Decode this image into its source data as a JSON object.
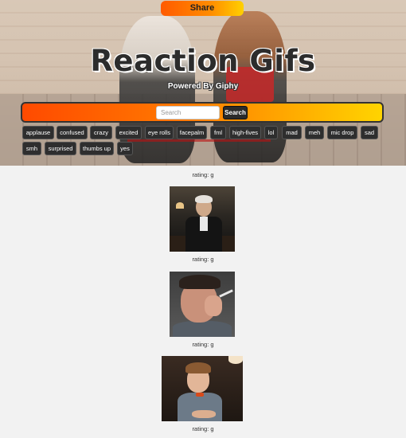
{
  "header": {
    "share_label": "Share",
    "title": "Reaction Gifs",
    "subtitle": "Powered By Giphy"
  },
  "search": {
    "placeholder": "Search",
    "button_label": "Search"
  },
  "tags": [
    "applause",
    "confused",
    "crazy",
    "excited",
    "eye rolls",
    "facepalm",
    "fml",
    "high-fives",
    "lol",
    "mad",
    "meh",
    "mic drop",
    "sad",
    "smh",
    "surprised",
    "thumbs up",
    "yes"
  ],
  "feed": {
    "top_rating": "rating: g",
    "items": [
      {
        "rating": "rating: g"
      },
      {
        "rating": "rating: g"
      },
      {
        "rating": "rating: g"
      }
    ]
  },
  "colors": {
    "accent_start": "#ff4a00",
    "accent_end": "#ffd400",
    "tag_bg": "#2e2e2e",
    "page_bg": "#f2f2f2"
  }
}
